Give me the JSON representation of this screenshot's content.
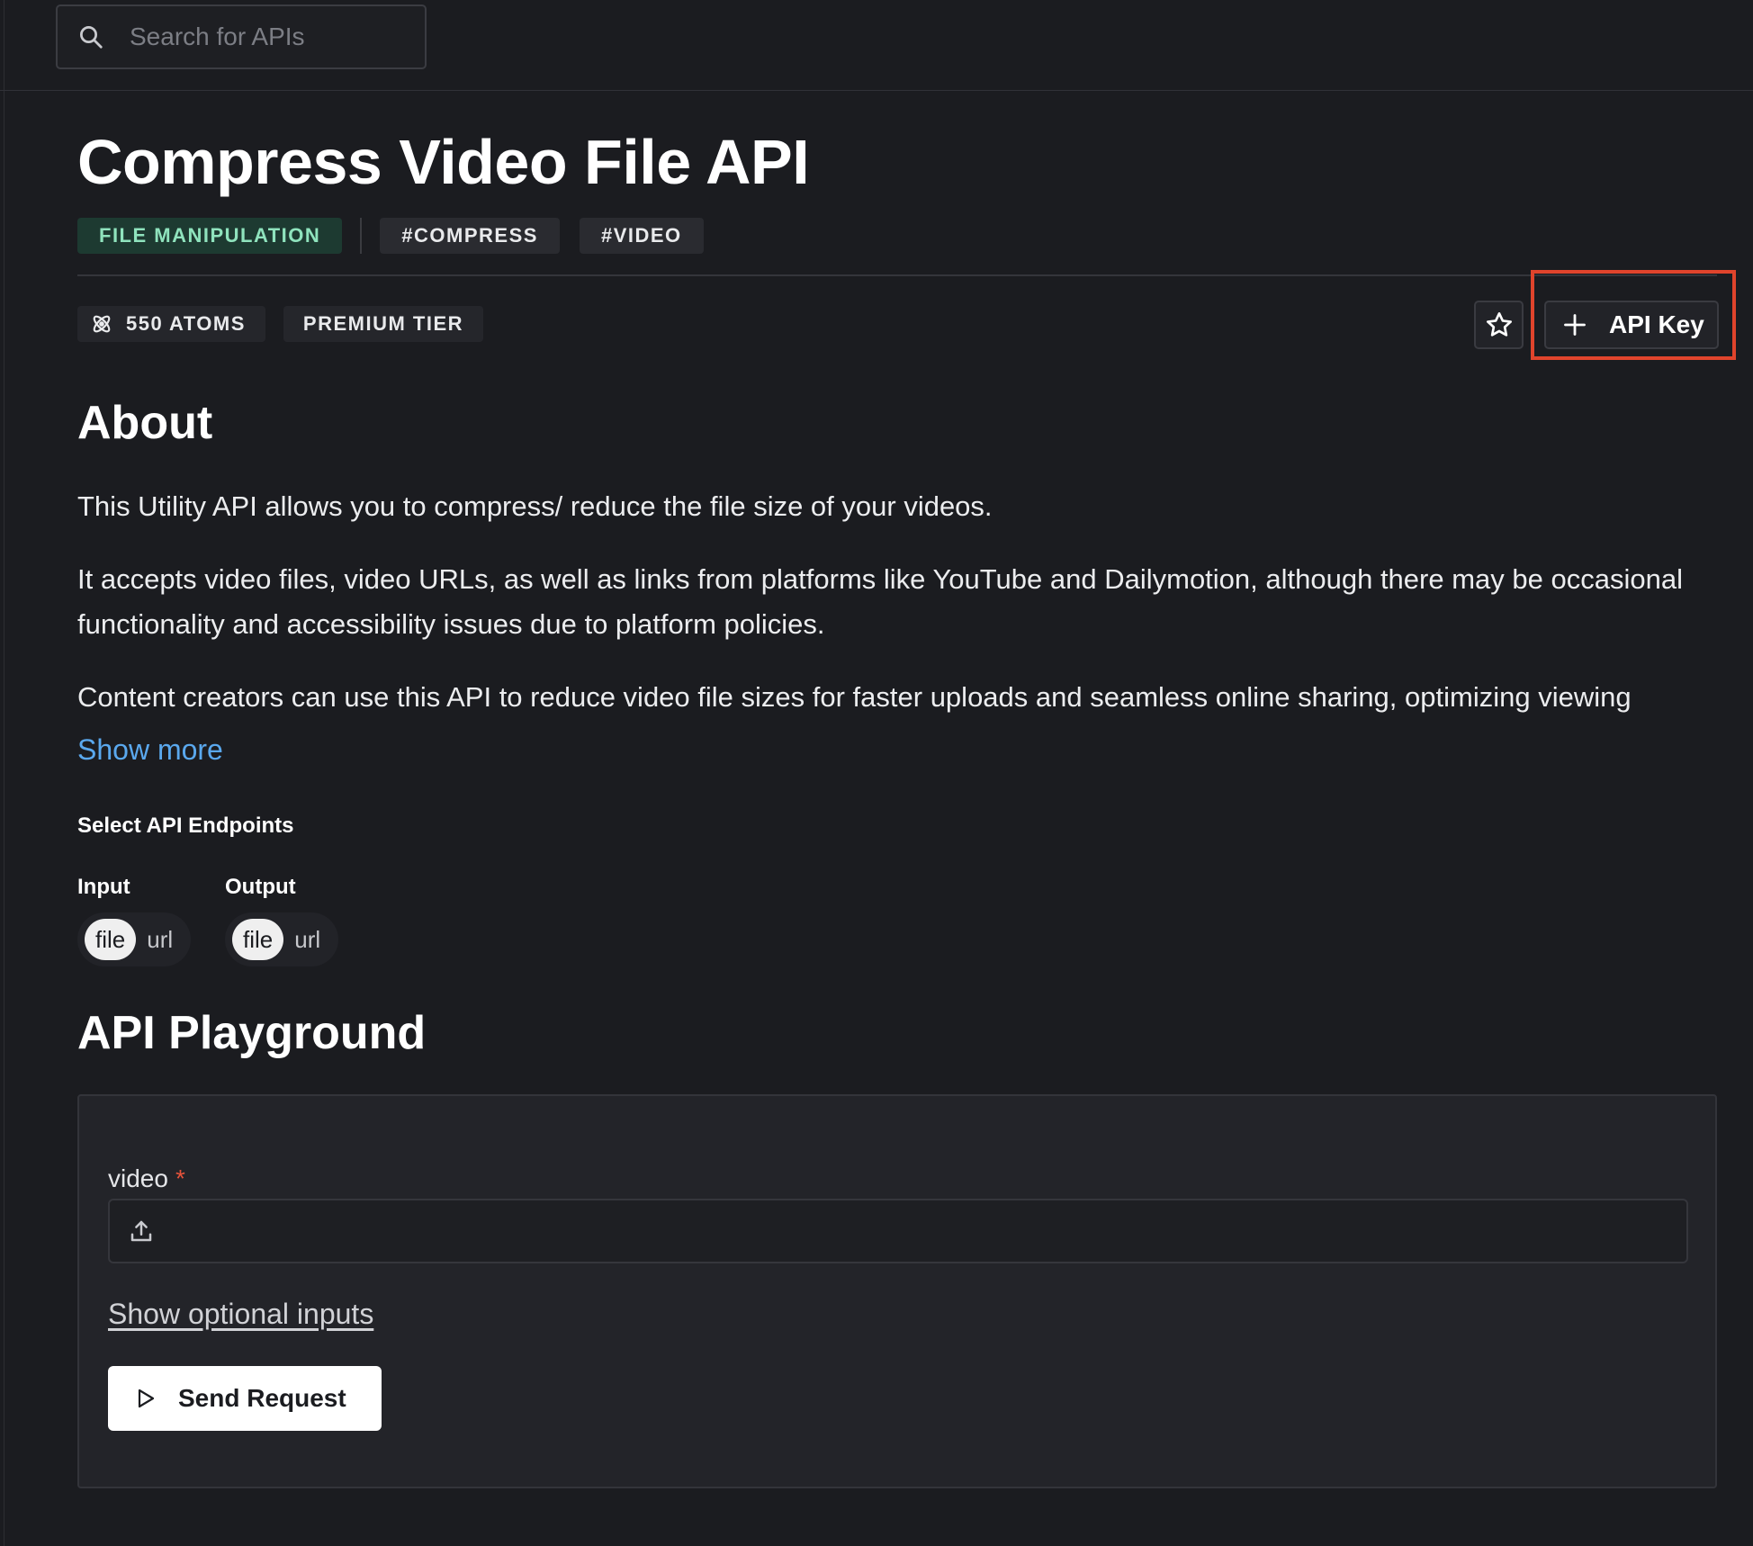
{
  "search": {
    "placeholder": "Search for APIs"
  },
  "api": {
    "title": "Compress Video File API",
    "category": "FILE MANIPULATION",
    "tags": [
      "#COMPRESS",
      "#VIDEO"
    ],
    "atoms": "550 ATOMS",
    "tier": "PREMIUM TIER"
  },
  "actions": {
    "api_key_label": "API Key"
  },
  "about": {
    "title": "About",
    "paragraphs": [
      "This Utility API allows you to compress/ reduce the file size of your videos.",
      "It accepts video files, video URLs, as well as links from platforms like YouTube and Dailymotion, although there may be occasional functionality and accessibility issues due to platform policies.",
      "Content creators can use this API to reduce video file sizes for faster uploads and seamless online sharing, optimizing viewing"
    ],
    "show_more": "Show more"
  },
  "endpoints": {
    "title": "Select API Endpoints",
    "input": {
      "label": "Input",
      "options": [
        "file",
        "url"
      ],
      "selected": "file"
    },
    "output": {
      "label": "Output",
      "options": [
        "file",
        "url"
      ],
      "selected": "file"
    }
  },
  "playground": {
    "title": "API Playground",
    "field_label": "video",
    "required_mark": "*",
    "optional_link": "Show optional inputs",
    "send_label": "Send Request"
  },
  "colors": {
    "background": "#1b1c20",
    "accent_link": "#5aa8ee",
    "category_bg": "#1d3a31",
    "category_text": "#8fe3bd",
    "highlight": "#e0442c"
  },
  "icons": {
    "search": "search-icon",
    "atom": "atom-icon",
    "star": "star-icon",
    "plus": "plus-icon",
    "upload": "upload-icon",
    "play": "play-icon"
  }
}
